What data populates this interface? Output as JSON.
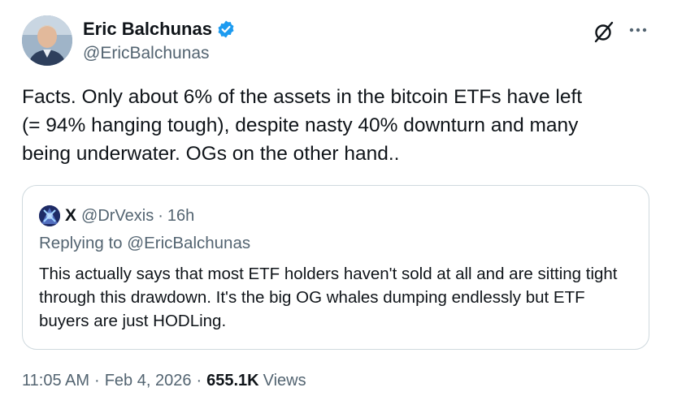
{
  "author": {
    "display_name": "Eric Balchunas",
    "handle": "@EricBalchunas",
    "verified": true
  },
  "tweet": {
    "text": "Facts. Only about 6% of the assets in the bitcoin ETFs have left\n(= 94% hanging tough), despite nasty 40% downturn and many\nbeing underwater. OGs on the other hand..",
    "time": "11:05 AM",
    "date": "Feb 4, 2026",
    "views_count": "655.1K",
    "views_label": "Views"
  },
  "quoted": {
    "name": "X",
    "handle": "@DrVexis",
    "age": "16h",
    "replying_prefix": "Replying to",
    "replying_to": "@EricBalchunas",
    "text": "This actually says that most ETF holders haven't sold at all and are sitting tight through this drawdown. It's the big OG whales dumping endlessly but ETF buyers are just HODLing."
  },
  "icons": {
    "verified": "verified-badge-icon",
    "grok": "grok-icon",
    "more": "more-icon"
  },
  "colors": {
    "text": "#0f1419",
    "secondary": "#536471",
    "verified": "#1d9bf0",
    "border": "#cfd9de"
  }
}
